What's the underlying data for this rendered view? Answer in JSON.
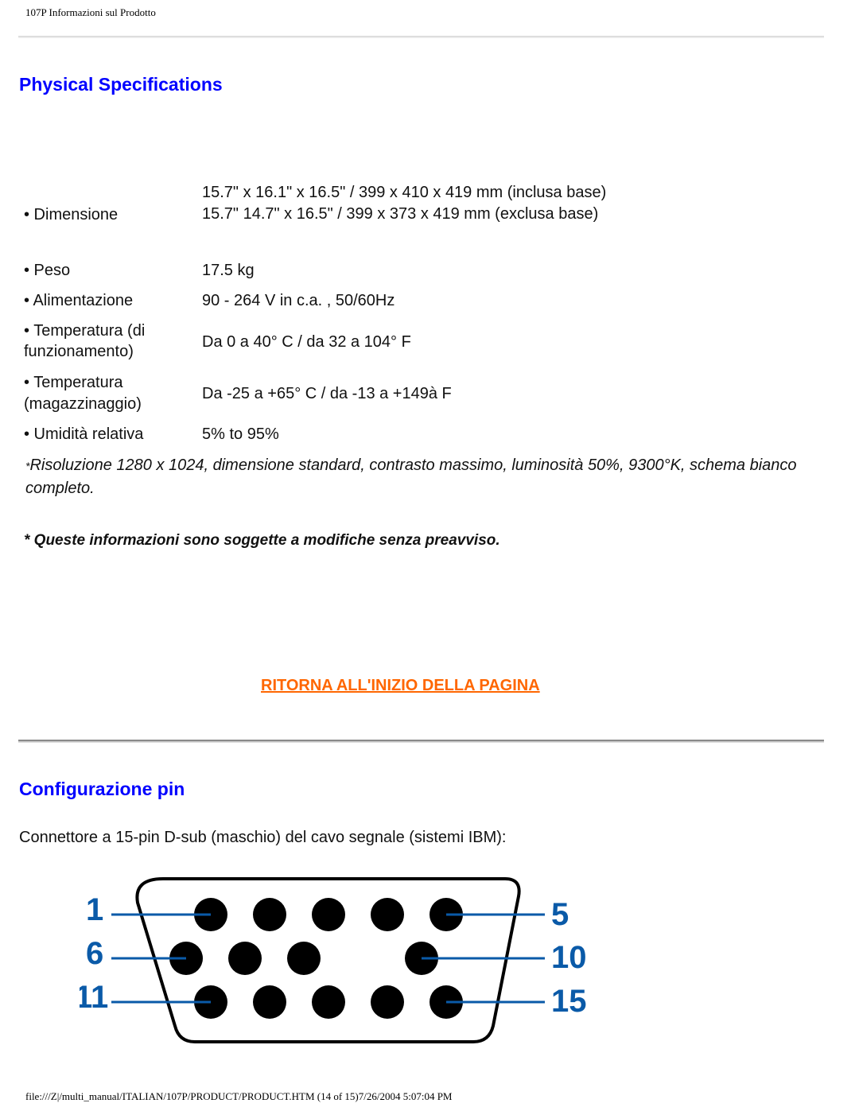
{
  "header": {
    "title": "107P Informazioni sul Prodotto"
  },
  "physical": {
    "heading": "Physical Specifications",
    "specs": [
      {
        "label": "• Dimensione",
        "values": [
          "15.7\" x 16.1\" x 16.5\" / 399 x 410 x 419 mm (inclusa base)",
          "15.7\"  14.7\" x 16.5\" / 399 x 373 x 419 mm (exclusa base)"
        ]
      },
      {
        "label": "• Peso",
        "values": [
          "17.5 kg"
        ]
      },
      {
        "label": "• Alimentazione",
        "values": [
          "90 - 264 V in c.a. , 50/60Hz"
        ]
      },
      {
        "label_lines": [
          "• Temperatura (di",
          "funzionamento)"
        ],
        "values": [
          "Da 0 a 40° C / da 32 a 104° F"
        ]
      },
      {
        "label_lines": [
          "• Temperatura",
          "(magazzinaggio)"
        ],
        "values": [
          "Da -25 a +65° C / da -13 a +149à F"
        ]
      },
      {
        "label": "• Umidità relativa",
        "values": [
          "5% to 95%"
        ]
      }
    ],
    "note_star": "*",
    "note": "Risoluzione 1280 x 1024, dimensione standard, contrasto massimo, luminosità 50%, 9300°K, schema bianco completo.",
    "warning": "* Queste informazioni sono soggette a modifiche senza preavviso.",
    "back_to_top": "RITORNA ALL'INIZIO DELLA PAGINA"
  },
  "pins": {
    "heading": "Configurazione pin",
    "description": "Connettore a 15-pin D-sub (maschio) del cavo segnale (sistemi IBM):",
    "labels": {
      "row1_left": "1",
      "row1_right": "5",
      "row2_left": "6",
      "row2_right": "10",
      "row3_left": "11",
      "row3_right": "15"
    },
    "present_pins": [
      1,
      2,
      3,
      4,
      5,
      6,
      7,
      8,
      10,
      11,
      12,
      13,
      14,
      15
    ],
    "missing_pins": [
      9
    ],
    "label_color": "#0a5aa8"
  },
  "footer": {
    "text": "file:///Z|/multi_manual/ITALIAN/107P/PRODUCT/PRODUCT.HTM (14 of 15)7/26/2004 5:07:04 PM"
  }
}
